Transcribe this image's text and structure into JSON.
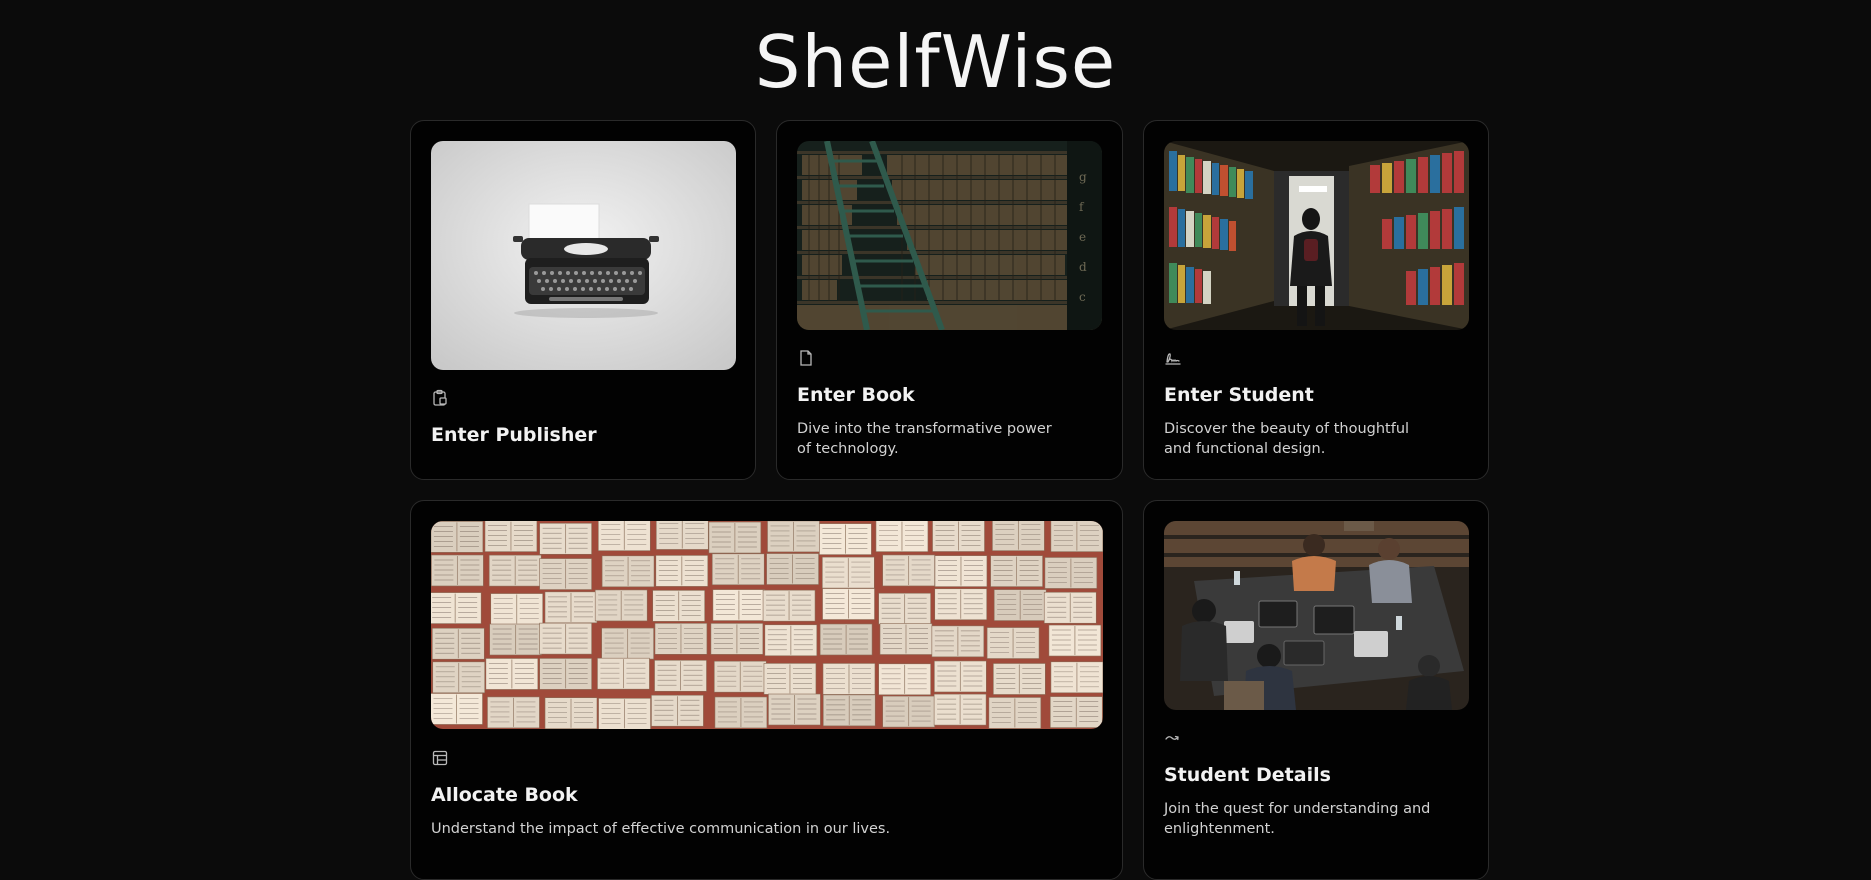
{
  "app": {
    "title": "ShelfWise"
  },
  "cards": [
    {
      "title": "Enter Publisher",
      "description": "",
      "icon": "clipboard-icon",
      "image": "typewriter-image"
    },
    {
      "title": "Enter Book",
      "description": "Dive into the transformative power of technology.",
      "icon": "file-icon",
      "image": "library-ladder-image"
    },
    {
      "title": "Enter Student",
      "description": "Discover the beauty of thoughtful and functional design.",
      "icon": "signature-icon",
      "image": "library-aisle-image"
    },
    {
      "title": "Allocate Book",
      "description": "Understand the impact of effective communication in our lives.",
      "icon": "table-icon",
      "image": "open-books-image"
    },
    {
      "title": "Student Details",
      "description": "Join the quest for understanding and enlightenment.",
      "icon": "arrow-wave-icon",
      "image": "students-laptops-image"
    }
  ],
  "colors": {
    "background": "#0b0b0b",
    "card_background": "#020202",
    "card_border": "#2a2a2a",
    "text": "#f2f2f2",
    "muted_text": "#d2d2d2"
  }
}
